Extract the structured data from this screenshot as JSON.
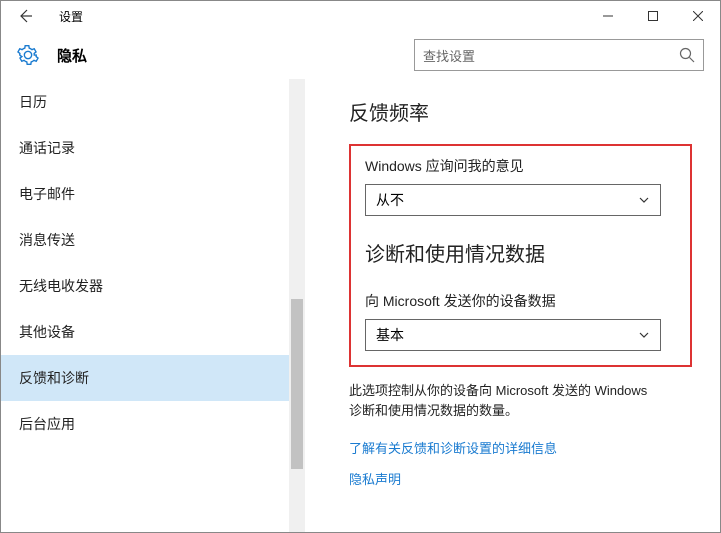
{
  "titlebar": {
    "title": "设置"
  },
  "header": {
    "title": "隐私",
    "search_placeholder": "查找设置"
  },
  "sidebar": {
    "items": [
      {
        "label": "日历"
      },
      {
        "label": "通话记录"
      },
      {
        "label": "电子邮件"
      },
      {
        "label": "消息传送"
      },
      {
        "label": "无线电收发器"
      },
      {
        "label": "其他设备"
      },
      {
        "label": "反馈和诊断"
      },
      {
        "label": "后台应用"
      }
    ],
    "selected_index": 6
  },
  "content": {
    "section1": {
      "heading": "反馈频率",
      "label": "Windows 应询问我的意见",
      "dropdown_value": "从不"
    },
    "section2": {
      "heading": "诊断和使用情况数据",
      "label": "向 Microsoft 发送你的设备数据",
      "dropdown_value": "基本"
    },
    "description": "此选项控制从你的设备向 Microsoft 发送的 Windows 诊断和使用情况数据的数量。",
    "link1": "了解有关反馈和诊断设置的详细信息",
    "link2": "隐私声明"
  }
}
